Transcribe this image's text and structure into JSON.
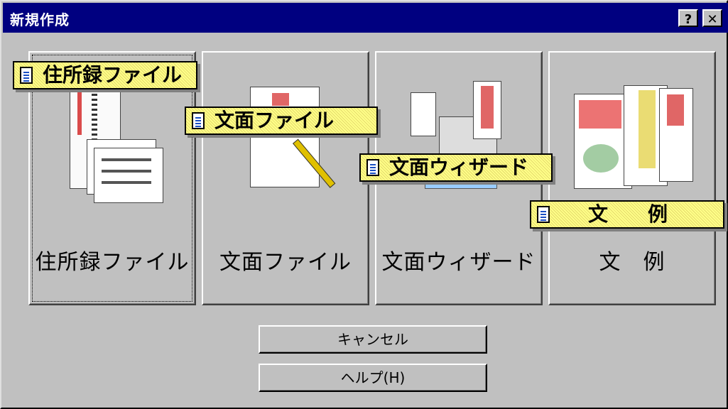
{
  "window": {
    "title": "新規作成"
  },
  "titlebar_buttons": {
    "help": "?",
    "close": "✕"
  },
  "tiles": [
    {
      "label": "住所録ファイル",
      "icon": "address-book-icon"
    },
    {
      "label": "文面ファイル",
      "icon": "card-design-icon"
    },
    {
      "label": "文面ウィザード",
      "icon": "wizard-icon"
    },
    {
      "label": "文　例",
      "icon": "card-examples-icon"
    }
  ],
  "callouts": [
    {
      "text": "住所録ファイル"
    },
    {
      "text": "文面ファイル"
    },
    {
      "text": "文面ウィザード"
    },
    {
      "text": "文　　例"
    }
  ],
  "buttons": {
    "cancel": "キャンセル",
    "help": "ヘルプ(H)"
  },
  "colors": {
    "titlebar": "#000080",
    "callout": "#ffff88",
    "face": "#c0c0c0"
  }
}
